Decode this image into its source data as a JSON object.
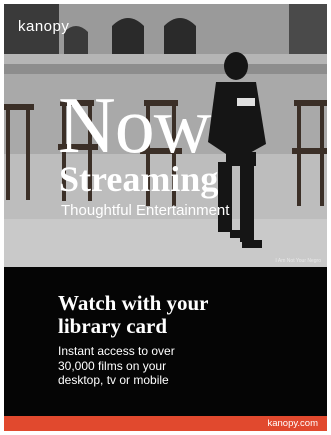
{
  "brand": {
    "logo": "kanopy"
  },
  "hero": {
    "headline": "Now",
    "subheadline": "Streaming",
    "tagline": "Thoughtful Entertainment",
    "photo_credit": "I Am Not Your Negro"
  },
  "body": {
    "title_line1": "Watch with your",
    "title_line2": "library card",
    "desc_line1": "Instant access to over",
    "desc_line2": "30,000 films on your",
    "desc_line3": "desktop, tv or mobile"
  },
  "footer": {
    "url": "kanopy.com"
  },
  "colors": {
    "accent": "#e1492e",
    "background": "#050505",
    "text": "#ffffff"
  }
}
